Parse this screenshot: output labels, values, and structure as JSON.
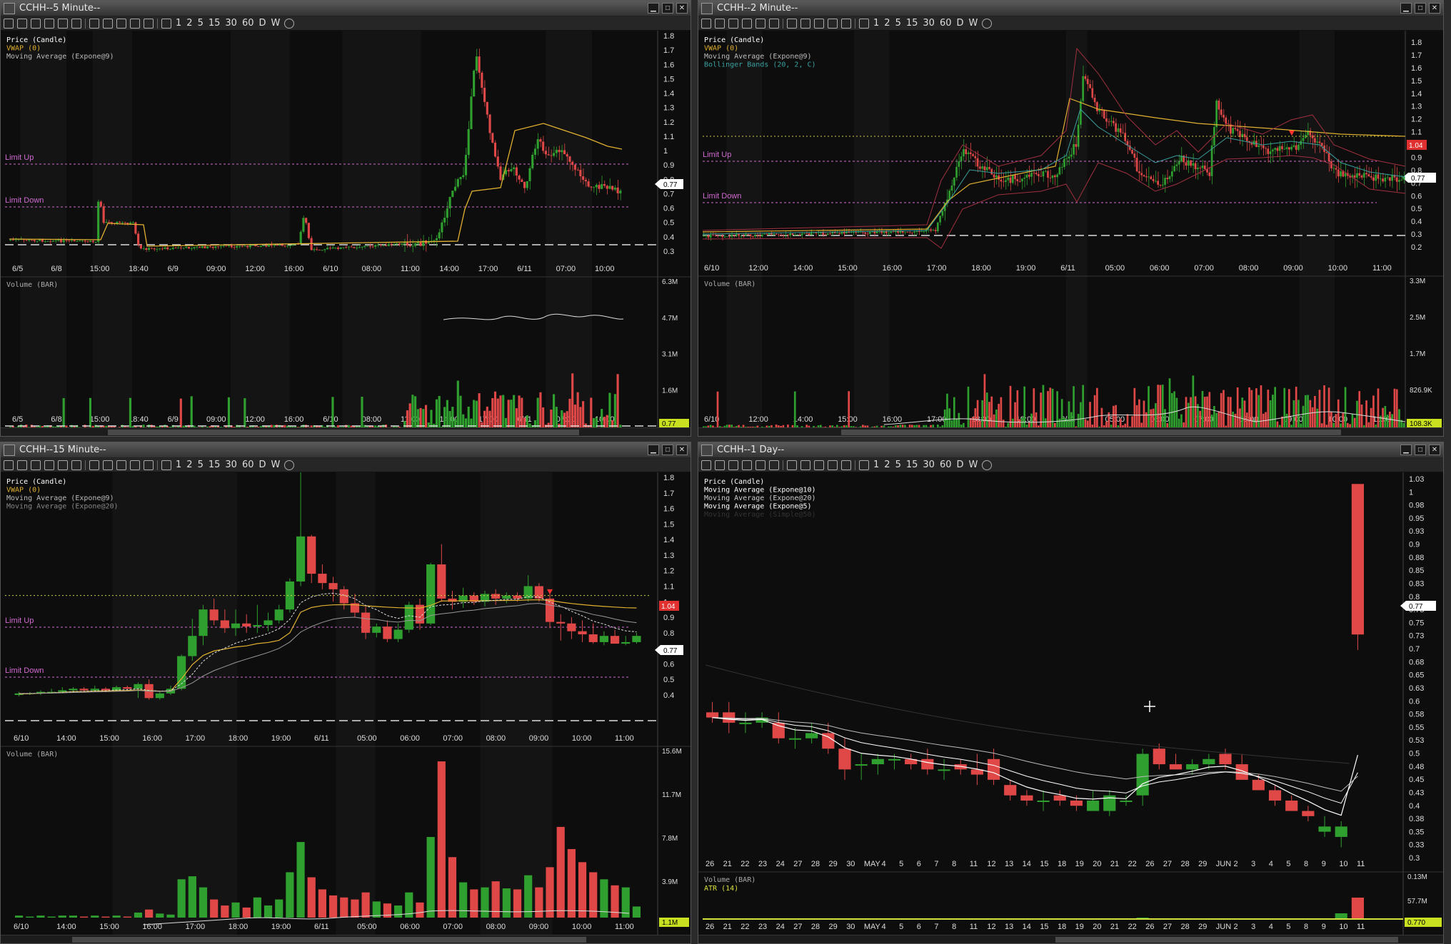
{
  "windows": [
    {
      "id": "w5m",
      "title": "CCHH--5 Minute--",
      "legend": [
        {
          "text": "Price (Candle)",
          "color": "#ffffff"
        },
        {
          "text": "VWAP (0)",
          "color": "#e0b030"
        },
        {
          "text": "Moving Average (Expone@9)",
          "color": "#bbbbbb"
        }
      ],
      "price_axis": [
        "1.8",
        "1.7",
        "1.6",
        "1.5",
        "1.4",
        "1.3",
        "1.2",
        "1.1",
        "1",
        "0.9",
        "0.8",
        "0.7",
        "0.6",
        "0.5",
        "0.4",
        "0.3"
      ],
      "limit_up": "Limit Up",
      "limit_down": "Limit Down",
      "last_price": "0.77",
      "time_labels": [
        "6/5",
        "6/8",
        "15:00",
        "18:40",
        "6/9",
        "09:00",
        "12:00",
        "16:00",
        "6/10",
        "08:00",
        "11:00",
        "14:00",
        "17:00",
        "6/11",
        "07:00",
        "10:00"
      ],
      "volume_label": "Volume (BAR)",
      "volume_axis": [
        "6.3M",
        "4.7M",
        "3.1M",
        "1.6M"
      ],
      "volume_last": "0.77"
    },
    {
      "id": "w2m",
      "title": "CCHH--2 Minute--",
      "legend": [
        {
          "text": "Price (Candle)",
          "color": "#ffffff"
        },
        {
          "text": "VWAP (0)",
          "color": "#e0b030"
        },
        {
          "text": "Moving Average (Expone@9)",
          "color": "#bbbbbb"
        },
        {
          "text": "Bollinger Bands (20, 2, C)",
          "color": "#3aa0a0"
        }
      ],
      "price_axis": [
        "1.8",
        "1.7",
        "1.6",
        "1.5",
        "1.4",
        "1.3",
        "1.2",
        "1.1",
        "1",
        "0.9",
        "0.8",
        "0.7",
        "0.6",
        "0.5",
        "0.4",
        "0.3",
        "0.2"
      ],
      "limit_up": "Limit Up",
      "limit_down": "Limit Down",
      "last_price": "0.77",
      "vwap_tag": "1.04",
      "time_labels": [
        "6/10",
        "12:00",
        "14:00",
        "15:00",
        "16:00",
        "17:00",
        "18:00",
        "19:00",
        "6/11",
        "05:00",
        "06:00",
        "07:00",
        "08:00",
        "09:00",
        "10:00",
        "11:00"
      ],
      "volume_label": "Volume (BAR)",
      "volume_axis": [
        "3.3M",
        "2.5M",
        "1.7M",
        "826.9K"
      ],
      "volume_last": "108.3K"
    },
    {
      "id": "w15m",
      "title": "CCHH--15 Minute--",
      "legend": [
        {
          "text": "Price (Candle)",
          "color": "#ffffff"
        },
        {
          "text": "VWAP (0)",
          "color": "#e0b030"
        },
        {
          "text": "Moving Average (Expone@9)",
          "color": "#bbbbbb"
        },
        {
          "text": "Moving Average (Expone@20)",
          "color": "#888888"
        }
      ],
      "price_axis": [
        "1.8",
        "1.7",
        "1.6",
        "1.5",
        "1.4",
        "1.3",
        "1.2",
        "1.1",
        "1",
        "0.9",
        "0.8",
        "0.7",
        "0.6",
        "0.5",
        "0.4"
      ],
      "limit_up": "Limit Up",
      "limit_down": "Limit Down",
      "last_price": "0.77",
      "vwap_tag": "1.04",
      "time_labels": [
        "6/10",
        "14:00",
        "15:00",
        "16:00",
        "17:00",
        "18:00",
        "19:00",
        "6/11",
        "05:00",
        "06:00",
        "07:00",
        "08:00",
        "09:00",
        "10:00",
        "11:00"
      ],
      "volume_label": "Volume (BAR)",
      "volume_axis": [
        "15.6M",
        "11.7M",
        "7.8M",
        "3.9M"
      ],
      "volume_last": "1.1M"
    },
    {
      "id": "w1d",
      "title": "CCHH--1 Day--",
      "legend": [
        {
          "text": "Price (Candle)",
          "color": "#ffffff"
        },
        {
          "text": "Moving Average (Expone@10)",
          "color": "#ffffff"
        },
        {
          "text": "Moving Average (Expone@20)",
          "color": "#cccccc"
        },
        {
          "text": "Moving Average (Expone@5)",
          "color": "#ffffff"
        },
        {
          "text": "Moving Average (Simple@50)",
          "color": "#333333"
        }
      ],
      "price_axis": [
        "1.03",
        "1",
        "0.98",
        "0.95",
        "0.93",
        "0.9",
        "0.88",
        "0.85",
        "0.83",
        "0.8",
        "0.78",
        "0.75",
        "0.73",
        "0.7",
        "0.68",
        "0.65",
        "0.63",
        "0.6",
        "0.58",
        "0.55",
        "0.53",
        "0.5",
        "0.48",
        "0.45",
        "0.43",
        "0.4",
        "0.38",
        "0.35",
        "0.33",
        "0.3"
      ],
      "last_price": "0.77",
      "time_labels": [
        "26",
        "21",
        "22",
        "23",
        "24",
        "27",
        "28",
        "29",
        "30",
        "MAY",
        "4",
        "5",
        "6",
        "7",
        "8",
        "11",
        "12",
        "13",
        "14",
        "15",
        "18",
        "19",
        "20",
        "21",
        "22",
        "26",
        "27",
        "28",
        "29",
        "JUN",
        "2",
        "3",
        "4",
        "5",
        "8",
        "9",
        "10",
        "11"
      ],
      "volume_label": "Volume (BAR)",
      "atr_label": "ATR (14)",
      "volume_axis": [
        "0.13M",
        "57.7M"
      ],
      "volume_last": "0.770"
    }
  ],
  "toolbar": {
    "intervals": [
      "1",
      "2",
      "5",
      "15",
      "30",
      "60",
      "D",
      "W"
    ]
  },
  "colors": {
    "up": "#2fa02f",
    "down": "#e04848",
    "vwap": "#e0b030",
    "limit": "#d06ad0",
    "grid_band": "#141414"
  },
  "chart_data": [
    {
      "type": "candlestick",
      "title": "CCHH--15 Minute--",
      "ylim": [
        0.3,
        1.85
      ],
      "candles": [
        [
          0.4,
          0.42,
          0.39,
          0.41
        ],
        [
          0.41,
          0.42,
          0.4,
          0.41
        ],
        [
          0.41,
          0.43,
          0.4,
          0.42
        ],
        [
          0.42,
          0.44,
          0.41,
          0.42
        ],
        [
          0.42,
          0.45,
          0.41,
          0.43
        ],
        [
          0.43,
          0.45,
          0.42,
          0.44
        ],
        [
          0.44,
          0.45,
          0.42,
          0.43
        ],
        [
          0.43,
          0.46,
          0.42,
          0.44
        ],
        [
          0.44,
          0.45,
          0.42,
          0.43
        ],
        [
          0.43,
          0.46,
          0.42,
          0.45
        ],
        [
          0.45,
          0.46,
          0.43,
          0.44
        ],
        [
          0.44,
          0.48,
          0.38,
          0.47
        ],
        [
          0.47,
          0.5,
          0.37,
          0.38
        ],
        [
          0.38,
          0.42,
          0.37,
          0.41
        ],
        [
          0.41,
          0.46,
          0.4,
          0.44
        ],
        [
          0.44,
          0.66,
          0.43,
          0.65
        ],
        [
          0.65,
          0.89,
          0.62,
          0.78
        ],
        [
          0.78,
          0.98,
          0.72,
          0.95
        ],
        [
          0.95,
          1.02,
          0.85,
          0.88
        ],
        [
          0.88,
          0.95,
          0.8,
          0.83
        ],
        [
          0.83,
          0.95,
          0.78,
          0.86
        ],
        [
          0.86,
          0.92,
          0.8,
          0.84
        ],
        [
          0.84,
          0.98,
          0.8,
          0.85
        ],
        [
          0.85,
          0.93,
          0.81,
          0.88
        ],
        [
          0.88,
          0.98,
          0.86,
          0.95
        ],
        [
          0.95,
          1.15,
          0.93,
          1.13
        ],
        [
          1.13,
          1.85,
          1.1,
          1.42
        ],
        [
          1.42,
          1.43,
          1.12,
          1.18
        ],
        [
          1.18,
          1.24,
          1.08,
          1.12
        ],
        [
          1.12,
          1.16,
          1.0,
          1.08
        ],
        [
          1.08,
          1.1,
          0.95,
          0.99
        ],
        [
          0.99,
          1.05,
          0.9,
          0.93
        ],
        [
          0.93,
          0.97,
          0.76,
          0.8
        ],
        [
          0.8,
          0.86,
          0.77,
          0.84
        ],
        [
          0.84,
          0.88,
          0.74,
          0.76
        ],
        [
          0.76,
          0.86,
          0.74,
          0.82
        ],
        [
          0.82,
          1.0,
          0.8,
          0.98
        ],
        [
          0.98,
          1.02,
          0.82,
          0.86
        ],
        [
          0.86,
          1.25,
          0.85,
          1.24
        ],
        [
          1.24,
          1.37,
          1.0,
          1.02
        ],
        [
          1.02,
          1.07,
          0.95,
          1.0
        ],
        [
          1.0,
          1.09,
          0.96,
          1.04
        ],
        [
          1.04,
          1.06,
          0.98,
          1.0
        ],
        [
          1.0,
          1.07,
          0.97,
          1.05
        ],
        [
          1.05,
          1.08,
          0.98,
          1.02
        ],
        [
          1.02,
          1.06,
          0.99,
          1.04
        ],
        [
          1.04,
          1.06,
          1.0,
          1.02
        ],
        [
          1.02,
          1.17,
          1.0,
          1.1
        ],
        [
          1.1,
          1.12,
          1.0,
          1.02
        ],
        [
          1.02,
          1.05,
          0.83,
          0.87
        ],
        [
          0.87,
          0.92,
          0.75,
          0.86
        ],
        [
          0.86,
          0.9,
          0.76,
          0.81
        ],
        [
          0.81,
          0.88,
          0.74,
          0.79
        ],
        [
          0.79,
          0.86,
          0.73,
          0.74
        ],
        [
          0.74,
          0.81,
          0.72,
          0.78
        ],
        [
          0.78,
          0.82,
          0.73,
          0.73
        ],
        [
          0.73,
          0.78,
          0.72,
          0.74
        ],
        [
          0.74,
          0.8,
          0.73,
          0.78
        ]
      ],
      "volume": [
        0.2,
        0.1,
        0.2,
        0.1,
        0.2,
        0.2,
        0.1,
        0.2,
        0.1,
        0.2,
        0.1,
        0.5,
        0.8,
        0.4,
        0.3,
        3.8,
        4.1,
        3.0,
        1.8,
        1.2,
        1.5,
        1.0,
        2.0,
        1.2,
        1.8,
        4.5,
        7.5,
        4.0,
        2.8,
        2.2,
        2.0,
        1.8,
        2.5,
        1.6,
        1.4,
        1.2,
        2.5,
        1.5,
        8.0,
        15.5,
        6.0,
        3.5,
        2.8,
        3.0,
        3.6,
        2.9,
        2.8,
        4.2,
        3.0,
        5.0,
        9.0,
        6.8,
        5.5,
        4.5,
        3.8,
        3.2,
        3.0,
        1.1
      ]
    },
    {
      "type": "candlestick",
      "title": "CCHH--1 Day--",
      "ylim": [
        0.28,
        1.04
      ],
      "candles": [
        [
          0.58,
          0.6,
          0.56,
          0.57
        ],
        [
          0.58,
          0.6,
          0.54,
          0.56
        ],
        [
          0.56,
          0.58,
          0.54,
          0.56
        ],
        [
          0.56,
          0.58,
          0.55,
          0.57
        ],
        [
          0.56,
          0.58,
          0.52,
          0.53
        ],
        [
          0.53,
          0.55,
          0.51,
          0.53
        ],
        [
          0.53,
          0.56,
          0.52,
          0.54
        ],
        [
          0.54,
          0.56,
          0.5,
          0.51
        ],
        [
          0.51,
          0.53,
          0.45,
          0.47
        ],
        [
          0.48,
          0.5,
          0.45,
          0.48
        ],
        [
          0.48,
          0.5,
          0.46,
          0.49
        ],
        [
          0.49,
          0.5,
          0.47,
          0.49
        ],
        [
          0.49,
          0.5,
          0.47,
          0.48
        ],
        [
          0.49,
          0.51,
          0.46,
          0.47
        ],
        [
          0.47,
          0.49,
          0.45,
          0.47
        ],
        [
          0.48,
          0.49,
          0.46,
          0.47
        ],
        [
          0.47,
          0.5,
          0.44,
          0.46
        ],
        [
          0.49,
          0.51,
          0.44,
          0.45
        ],
        [
          0.44,
          0.45,
          0.41,
          0.42
        ],
        [
          0.42,
          0.43,
          0.4,
          0.41
        ],
        [
          0.41,
          0.43,
          0.39,
          0.41
        ],
        [
          0.42,
          0.43,
          0.4,
          0.41
        ],
        [
          0.41,
          0.42,
          0.39,
          0.4
        ],
        [
          0.39,
          0.43,
          0.39,
          0.41
        ],
        [
          0.39,
          0.43,
          0.38,
          0.42
        ],
        [
          0.41,
          0.42,
          0.4,
          0.41
        ],
        [
          0.42,
          0.51,
          0.4,
          0.5
        ],
        [
          0.51,
          0.52,
          0.47,
          0.48
        ],
        [
          0.48,
          0.5,
          0.47,
          0.47
        ],
        [
          0.47,
          0.49,
          0.46,
          0.48
        ],
        [
          0.48,
          0.5,
          0.47,
          0.49
        ],
        [
          0.5,
          0.51,
          0.47,
          0.48
        ],
        [
          0.48,
          0.5,
          0.45,
          0.45
        ],
        [
          0.45,
          0.46,
          0.43,
          0.43
        ],
        [
          0.43,
          0.44,
          0.4,
          0.41
        ],
        [
          0.41,
          0.42,
          0.39,
          0.39
        ],
        [
          0.39,
          0.4,
          0.37,
          0.38
        ],
        [
          0.35,
          0.38,
          0.34,
          0.36
        ],
        [
          0.34,
          0.37,
          0.32,
          0.36
        ],
        [
          1.02,
          1.02,
          0.7,
          0.73
        ]
      ],
      "volume": [
        1,
        1,
        1,
        1,
        1,
        1,
        1,
        1,
        1,
        1,
        1,
        1,
        1,
        1,
        1,
        1,
        1,
        1,
        1,
        1,
        1,
        1,
        1,
        1,
        1,
        1,
        2,
        1,
        1,
        1,
        1,
        1,
        1,
        1,
        1,
        1,
        1,
        1,
        8,
        30
      ]
    }
  ]
}
